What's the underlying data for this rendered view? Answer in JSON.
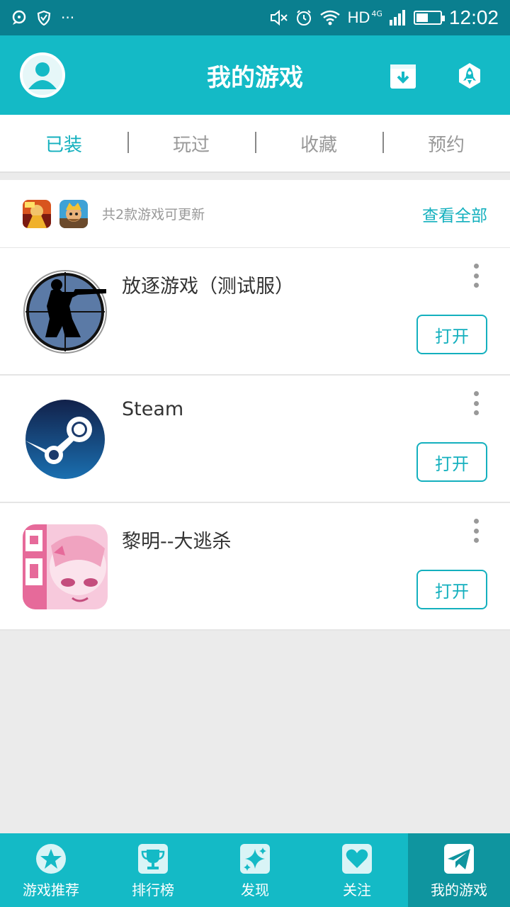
{
  "status_bar": {
    "time": "12:02",
    "network": "HD",
    "network_gen": "4G",
    "battery_level": 0.45,
    "left_icons": [
      "chat-bubble-icon",
      "shield-check-icon",
      "more-dots-icon"
    ],
    "right_icons": [
      "mute-icon",
      "alarm-icon",
      "wifi-icon",
      "signal-icon",
      "battery-icon"
    ],
    "more_text": "···"
  },
  "app_bar": {
    "title": "我的游戏",
    "left_icon": "avatar-icon",
    "right_icons": [
      "download-box-icon",
      "rocket-icon"
    ]
  },
  "tabs": [
    {
      "label": "已装",
      "active": true
    },
    {
      "label": "玩过",
      "active": false
    },
    {
      "label": "收藏",
      "active": false
    },
    {
      "label": "预约",
      "active": false
    }
  ],
  "update_banner": {
    "text": "共2款游戏可更新",
    "link": "查看全部",
    "icons": [
      "honor-of-kings-icon",
      "clash-royale-icon"
    ]
  },
  "games": [
    {
      "name": "放逐游戏（测试服）",
      "button": "打开",
      "icon": "sniper-scope-icon"
    },
    {
      "name": "Steam",
      "button": "打开",
      "icon": "steam-icon"
    },
    {
      "name": "黎明--大逃杀",
      "button": "打开",
      "icon": "anime-girl-icon"
    }
  ],
  "bottom_nav": [
    {
      "label": "游戏推荐",
      "icon": "star-icon",
      "active": false
    },
    {
      "label": "排行榜",
      "icon": "trophy-icon",
      "active": false
    },
    {
      "label": "发现",
      "icon": "sparkle-icon",
      "active": false
    },
    {
      "label": "关注",
      "icon": "heart-icon",
      "active": false
    },
    {
      "label": "我的游戏",
      "icon": "paper-plane-icon",
      "active": true
    }
  ],
  "colors": {
    "primary": "#14bac6",
    "status_bar": "#0a7f8f",
    "accent_text": "#14b0be",
    "nav_active": "#0f959f"
  }
}
